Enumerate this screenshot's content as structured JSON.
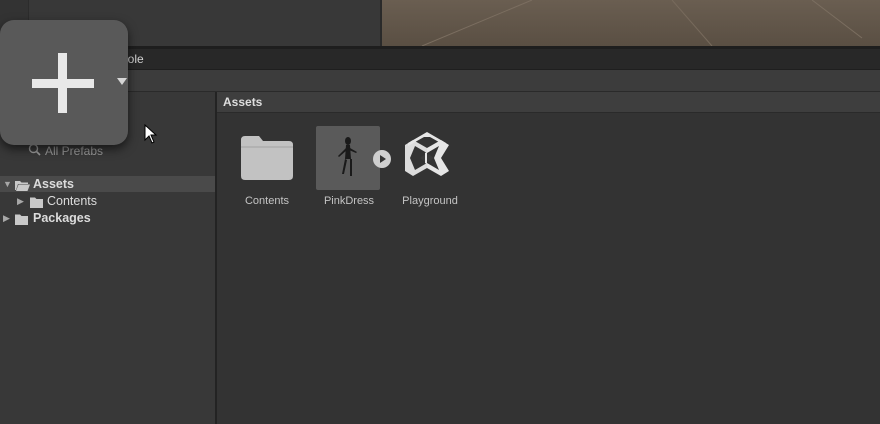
{
  "tabs": {
    "project": "",
    "console": "nsole"
  },
  "tree": {
    "favorites_label": "All Prefabs",
    "items": [
      {
        "label": "Assets",
        "bold": true,
        "selected": true
      },
      {
        "label": "Contents",
        "bold": false,
        "selected": false
      },
      {
        "label": "Packages",
        "bold": true,
        "selected": false
      }
    ]
  },
  "content": {
    "breadcrumb": "Assets",
    "assets": [
      {
        "label": "Contents",
        "icon": "folder-icon"
      },
      {
        "label": "PinkDress",
        "icon": "model-thumbnail"
      },
      {
        "label": "Playground",
        "icon": "unity-logo-icon"
      }
    ]
  },
  "add_button": {
    "icon": "plus-icon"
  },
  "colors": {
    "background": "#3c3c3c",
    "panel": "#333333",
    "selection": "#4a4a4a",
    "scene": "#5e5347"
  }
}
